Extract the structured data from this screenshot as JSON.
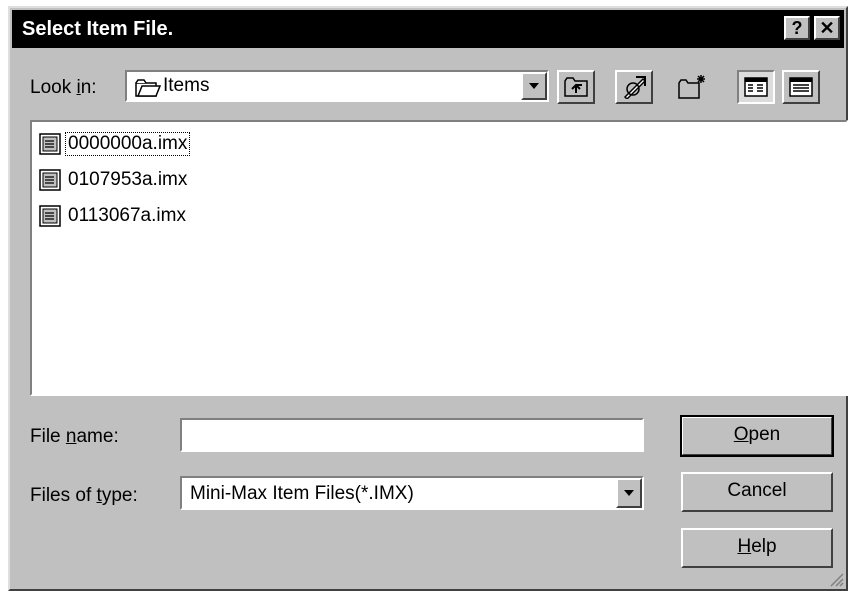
{
  "title": "Select Item File.",
  "titlebar": {
    "help": "?",
    "close": "✕"
  },
  "look_in": {
    "label_pre": "Look ",
    "label_key": "i",
    "label_post": "n:",
    "value": "Items",
    "icon": "folder-icon"
  },
  "toolbar": {
    "up_one_level": "up-folder-icon",
    "desktop": "desktop-icon",
    "new_folder": "new-folder-icon",
    "list_view": "list-view-icon",
    "details_view": "details-view-icon"
  },
  "files": [
    {
      "name": "0000000a.imx",
      "icon": "document-icon"
    },
    {
      "name": "0107953a.imx",
      "icon": "document-icon"
    },
    {
      "name": "0113067a.imx",
      "icon": "document-icon"
    }
  ],
  "file_name": {
    "label_pre": "File ",
    "label_key": "n",
    "label_post": "ame:",
    "value": ""
  },
  "file_type": {
    "label_pre": "Files of ",
    "label_key": "t",
    "label_post": "ype:",
    "value": "Mini-Max Item Files(*.IMX)"
  },
  "buttons": {
    "open": {
      "key": "O",
      "rest": "pen"
    },
    "cancel": "Cancel",
    "help": {
      "key": "H",
      "rest": "elp"
    }
  }
}
